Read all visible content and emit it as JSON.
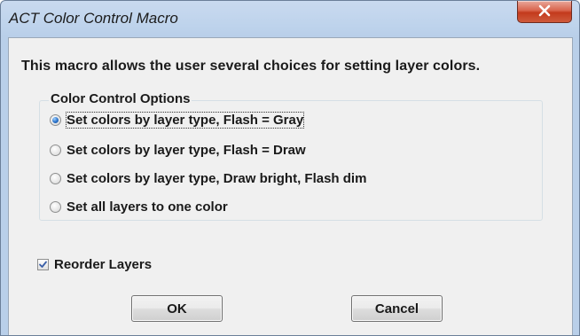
{
  "window": {
    "title": "ACT Color Control Macro",
    "close_glyph": "X"
  },
  "dialog": {
    "description": "This macro allows the user several choices for setting layer colors.",
    "options_group": {
      "legend": "Color Control Options",
      "options": [
        {
          "label": "Set colors by layer type, Flash = Gray",
          "selected": true
        },
        {
          "label": "Set colors by layer type, Flash = Draw",
          "selected": false
        },
        {
          "label": "Set colors by layer type, Draw bright, Flash dim",
          "selected": false
        },
        {
          "label": "Set all layers to one color",
          "selected": false
        }
      ]
    },
    "reorder_layers": {
      "label": "Reorder Layers",
      "checked": true
    },
    "buttons": {
      "ok_label": "OK",
      "cancel_label": "Cancel"
    }
  },
  "colors": {
    "title_bar": "#bed3ec",
    "close_button": "#c9462a",
    "dialog_background": "#f0f0f0",
    "radio_selected": "#2a72c8"
  }
}
